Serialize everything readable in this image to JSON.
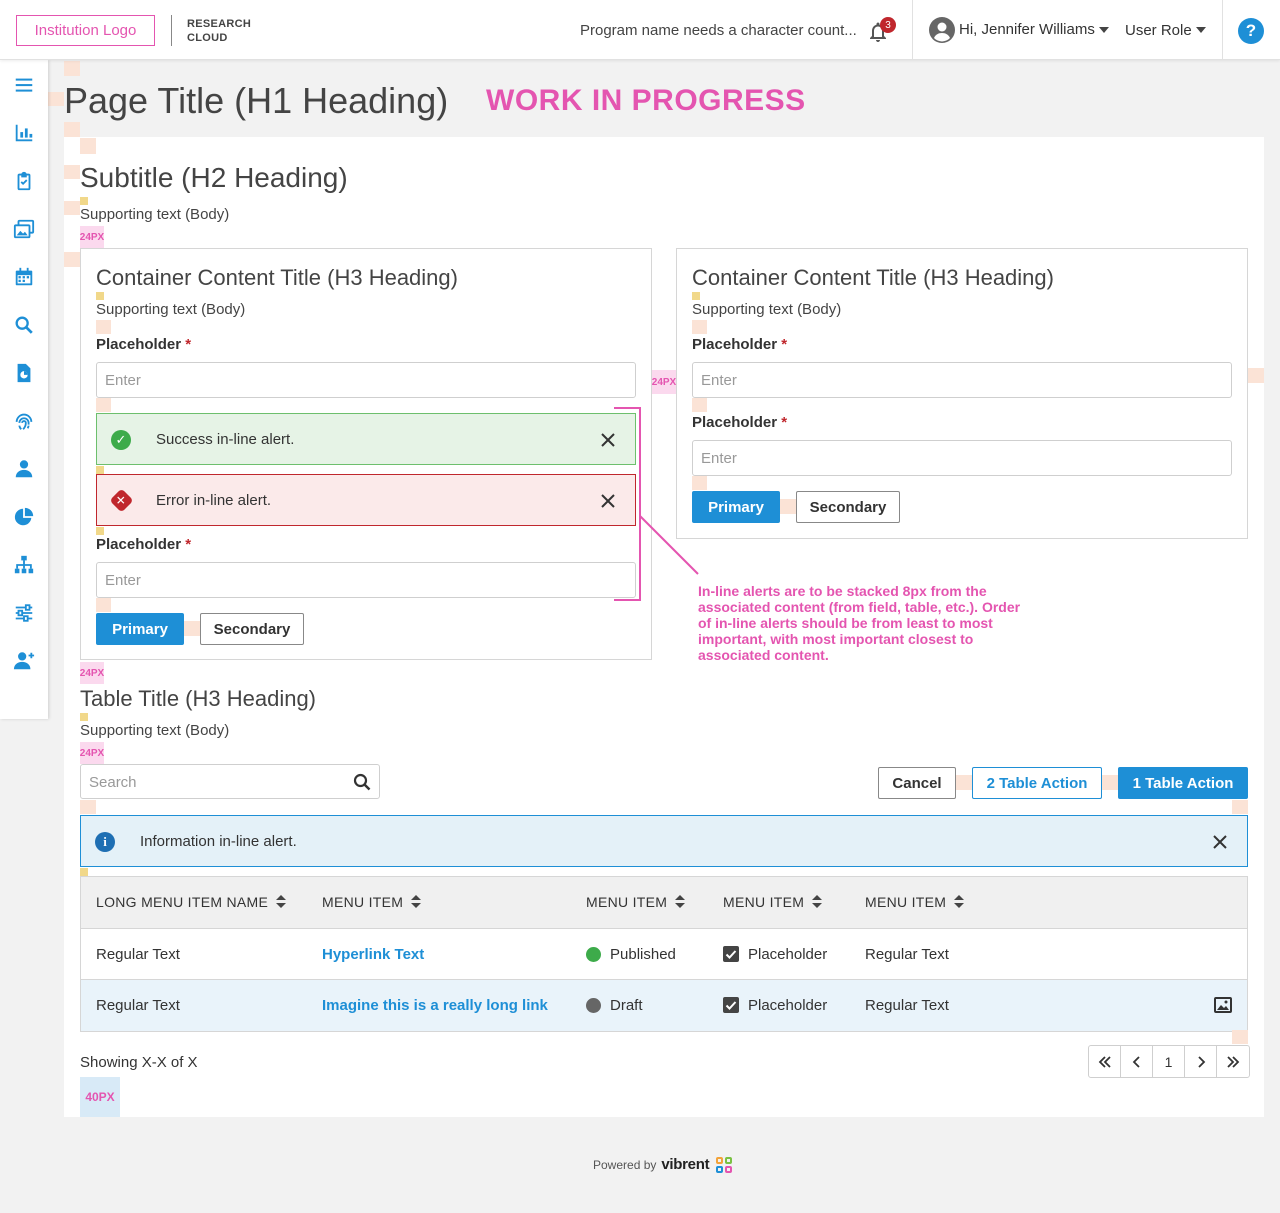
{
  "header": {
    "institution_logo": "Institution Logo",
    "brand_line1": "RESEARCH",
    "brand_line2": "CLOUD",
    "program_name": "Program name needs a character count...",
    "notification_count": "3",
    "greeting": "Hi, Jennifer Williams",
    "user_role": "User Role",
    "help": "?"
  },
  "sidebar": {
    "icons": [
      "menu-icon",
      "chart-icon",
      "clipboard-icon",
      "media-icon",
      "calendar-icon",
      "search-icon",
      "report-icon",
      "fingerprint-icon",
      "user-icon",
      "pie-chart-icon",
      "org-chart-icon",
      "sliders-icon",
      "add-user-icon"
    ]
  },
  "page": {
    "title": "Page Title (H1 Heading)",
    "wip": "WORK IN PROGRESS",
    "subtitle": "Subtitle (H2 Heading)",
    "supporting": "Supporting text (Body)"
  },
  "spacing": {
    "s24": "24PX",
    "s40": "40PX",
    "s16": "16PX"
  },
  "card_left": {
    "title": "Container Content Title (H3 Heading)",
    "supporting": "Supporting text (Body)",
    "field1_label": "Placeholder",
    "field1_placeholder": "Enter",
    "success_alert": "Success in-line alert.",
    "error_alert": "Error in-line alert.",
    "field2_label": "Placeholder",
    "field2_placeholder": "Enter",
    "primary": "Primary",
    "secondary": "Secondary"
  },
  "card_right": {
    "title": "Container Content Title (H3 Heading)",
    "supporting": "Supporting text (Body)",
    "field1_label": "Placeholder",
    "field1_placeholder": "Enter",
    "field2_label": "Placeholder",
    "field2_placeholder": "Enter",
    "primary": "Primary",
    "secondary": "Secondary"
  },
  "annotation": "In-line alerts are to be stacked 8px from the associated content (from field, table, etc.). Order of in-line alerts should be from least to most important, with most important closest to associated content.",
  "table_section": {
    "title": "Table Title (H3 Heading)",
    "supporting": "Supporting text (Body)",
    "search_placeholder": "Search",
    "cancel": "Cancel",
    "action2": "2 Table Action",
    "action1": "1 Table Action",
    "info_alert": "Information in-line alert.",
    "columns": [
      "LONG MENU ITEM NAME",
      "MENU ITEM",
      "MENU ITEM",
      "MENU ITEM",
      "MENU ITEM"
    ],
    "rows": [
      {
        "c1": "Regular Text",
        "c2": "Hyperlink Text",
        "status": "Published",
        "status_color": "#3dab4a",
        "check": "Placeholder",
        "c5": "Regular Text"
      },
      {
        "c1": "Regular Text",
        "c2": "Imagine this is a really long link",
        "status": "Draft",
        "status_color": "#666666",
        "check": "Placeholder",
        "c5": "Regular Text"
      }
    ],
    "showing": "Showing X-X of X",
    "page": "1"
  },
  "footer": {
    "powered_by": "Powered by",
    "vendor": "vibrent"
  },
  "colors": {
    "accent": "#1e8fd6",
    "annotation_pink": "#e455b0",
    "error": "#c0272d",
    "success": "#3dab4a"
  }
}
